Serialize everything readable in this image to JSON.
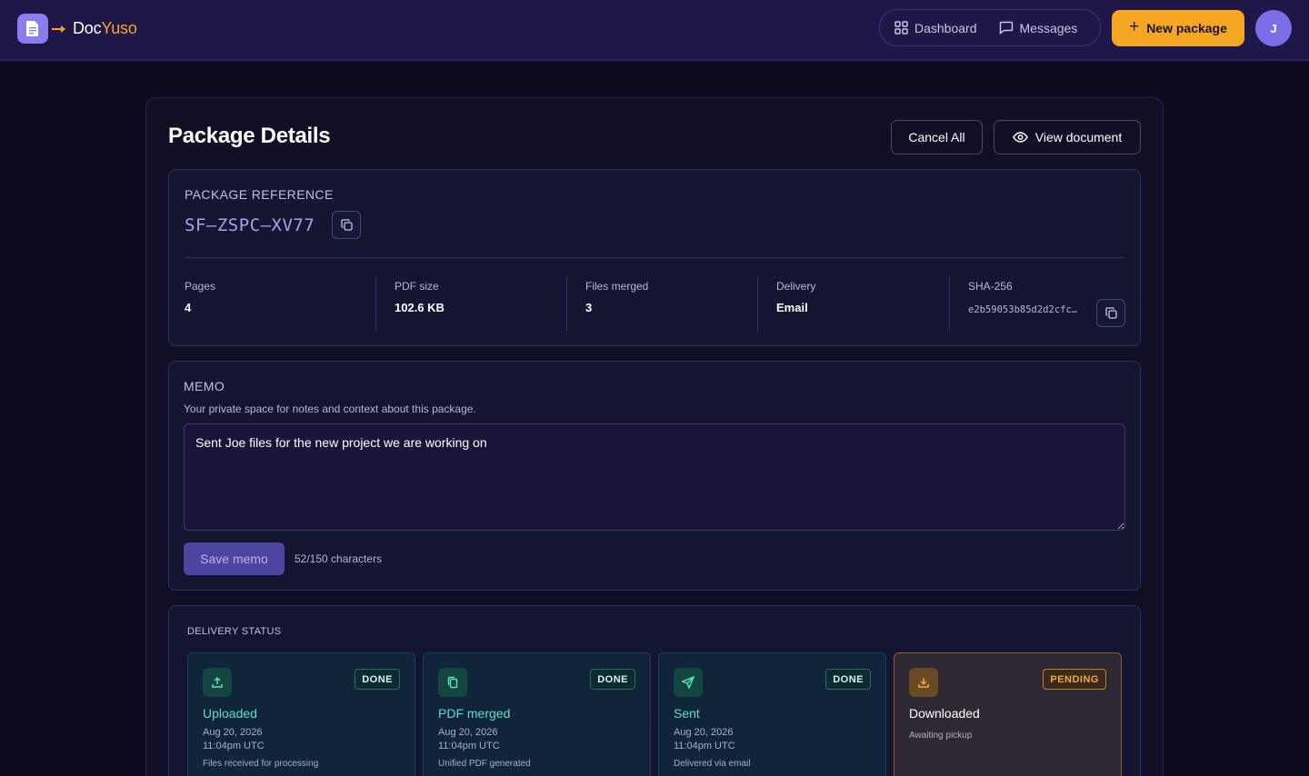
{
  "brand": {
    "name_a": "Doc",
    "name_b": "Yuso"
  },
  "nav": {
    "dashboard": "Dashboard",
    "messages": "Messages",
    "new_package": "New package",
    "avatar_initial": "J"
  },
  "header": {
    "title": "Package Details",
    "cancel_all": "Cancel All",
    "view_document": "View document"
  },
  "reference": {
    "label": "PACKAGE REFERENCE",
    "code": "SF–ZSPC–XV77",
    "stats": {
      "pages_label": "Pages",
      "pages_value": "4",
      "size_label": "PDF size",
      "size_value": "102.6 KB",
      "merged_label": "Files merged",
      "merged_value": "3",
      "delivery_label": "Delivery",
      "delivery_value": "Email",
      "sha_label": "SHA-256",
      "sha_value": "e2b59053b85d2d2cfc…"
    }
  },
  "memo": {
    "label": "MEMO",
    "subtitle": "Your private space for notes and context about this package.",
    "text": "Sent Joe files for the new project we are working on",
    "save_label": "Save memo",
    "char_count": "52/150 characters"
  },
  "delivery": {
    "label": "DELIVERY STATUS",
    "steps": [
      {
        "title": "Uploaded",
        "badge": "DONE",
        "date": "Aug 20, 2026",
        "time": "11:04pm UTC",
        "desc": "Files received for processing",
        "icon": "upload-icon"
      },
      {
        "title": "PDF merged",
        "badge": "DONE",
        "date": "Aug 20, 2026",
        "time": "11:04pm UTC",
        "desc": "Unified PDF generated",
        "icon": "files-icon"
      },
      {
        "title": "Sent",
        "badge": "DONE",
        "date": "Aug 20, 2026",
        "time": "11:04pm UTC",
        "desc": "Delivered via email",
        "icon": "send-icon"
      },
      {
        "title": "Downloaded",
        "badge": "PENDING",
        "date": "Awaiting pickup",
        "icon": "download-icon"
      }
    ]
  },
  "colors": {
    "accent": "#f5a623",
    "brand": "#8b7cf0",
    "done": "#5fe0c0",
    "background": "#0d0b1f"
  }
}
